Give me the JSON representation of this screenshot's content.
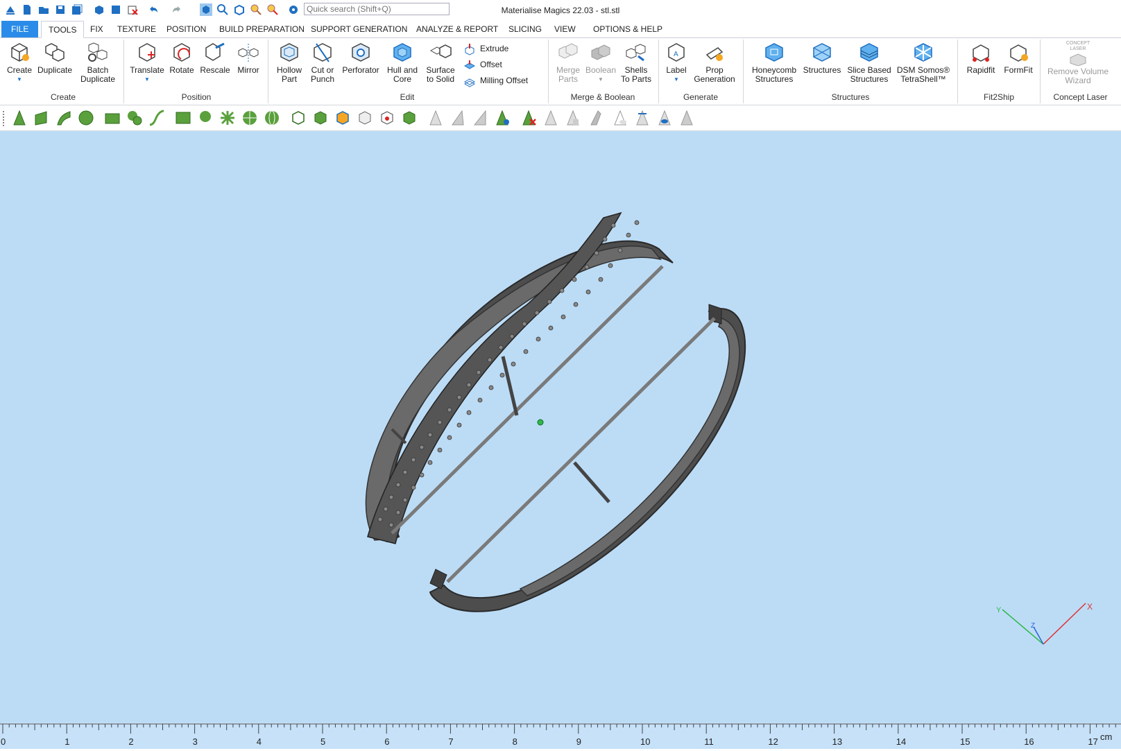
{
  "app_title": "Materialise Magics 22.03 - stl.stl",
  "quick_search_placeholder": "Quick search (Shift+Q)",
  "tabs": [
    "FILE",
    "TOOLS",
    "FIX",
    "TEXTURE",
    "POSITION",
    "BUILD PREPARATION",
    "SUPPORT GENERATION",
    "ANALYZE & REPORT",
    "SLICING",
    "VIEW",
    "OPTIONS & HELP"
  ],
  "active_tab": "TOOLS",
  "ribbon": {
    "create": {
      "group": "Create",
      "buttons": [
        [
          "Create",
          ""
        ],
        [
          "Duplicate",
          ""
        ],
        [
          "Batch",
          "Duplicate"
        ]
      ]
    },
    "position": {
      "group": "Position",
      "buttons": [
        [
          "Translate",
          ""
        ],
        [
          "Rotate",
          ""
        ],
        [
          "Rescale",
          ""
        ],
        [
          "Mirror",
          ""
        ]
      ]
    },
    "edit": {
      "group": "Edit",
      "buttons": [
        [
          "Hollow",
          "Part"
        ],
        [
          "Cut or",
          "Punch"
        ],
        [
          "Perforator",
          ""
        ],
        [
          "Hull and",
          "Core"
        ],
        [
          "Surface",
          "to Solid"
        ]
      ],
      "small": [
        "Extrude",
        "Offset",
        "Milling Offset"
      ]
    },
    "merge": {
      "group": "Merge & Boolean",
      "buttons": [
        [
          "Merge",
          "Parts"
        ],
        [
          "Boolean",
          ""
        ],
        [
          "Shells",
          "To Parts"
        ]
      ]
    },
    "generate": {
      "group": "Generate",
      "buttons": [
        [
          "Label",
          ""
        ],
        [
          "Prop",
          "Generation"
        ]
      ]
    },
    "structures": {
      "group": "Structures",
      "buttons": [
        [
          "Honeycomb",
          "Structures"
        ],
        [
          "Structures",
          ""
        ],
        [
          "Slice Based",
          "Structures"
        ],
        [
          "DSM Somos®",
          "TetraShell™"
        ]
      ]
    },
    "fit2ship": {
      "group": "Fit2Ship",
      "buttons": [
        [
          "Rapidfit",
          ""
        ],
        [
          "FormFit",
          ""
        ]
      ]
    },
    "concept": {
      "group": "Concept Laser",
      "buttons": [
        [
          "Remove Volume",
          "Wizard"
        ]
      ],
      "logo": "CONCEPT LASER"
    }
  },
  "axis_labels": {
    "x": "X",
    "y": "Y",
    "z": "Z"
  },
  "ruler": {
    "unit": "cm",
    "ticks": [
      "0",
      "1",
      "2",
      "3",
      "4",
      "5",
      "6",
      "7",
      "8",
      "9",
      "10",
      "11",
      "12",
      "13",
      "14",
      "15",
      "16",
      "17"
    ]
  },
  "colors": {
    "viewport": "#bcdcf6",
    "accent": "#2a8ce8",
    "part": "#555555"
  }
}
